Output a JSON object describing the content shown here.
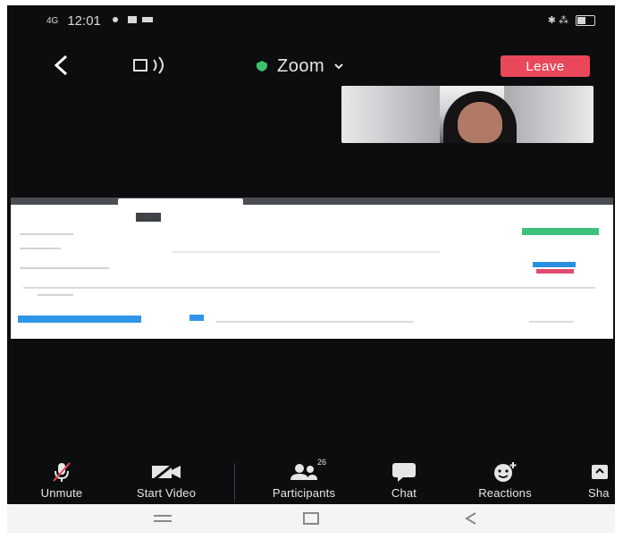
{
  "status_bar": {
    "signal": "4G",
    "time": "12:01",
    "right_text": "✱ ⁂"
  },
  "meeting": {
    "title": "Zoom",
    "leave_label": "Leave",
    "shield_color": "#3cc26e",
    "leave_color": "#e9485a"
  },
  "toolbar": {
    "unmute_label": "Unmute",
    "start_video_label": "Start Video",
    "participants_label": "Participants",
    "participants_count": "26",
    "chat_label": "Chat",
    "reactions_label": "Reactions",
    "share_label": "Sha"
  },
  "nav": {
    "recents_icon": "recents-icon",
    "home_icon": "home-icon",
    "back_icon": "back-icon"
  },
  "icons": [
    "back-chevron-icon",
    "speaker-icon",
    "shield-icon",
    "chevron-down-icon",
    "microphone-muted-icon",
    "video-off-icon",
    "participants-icon",
    "chat-icon",
    "reactions-icon",
    "share-icon"
  ]
}
